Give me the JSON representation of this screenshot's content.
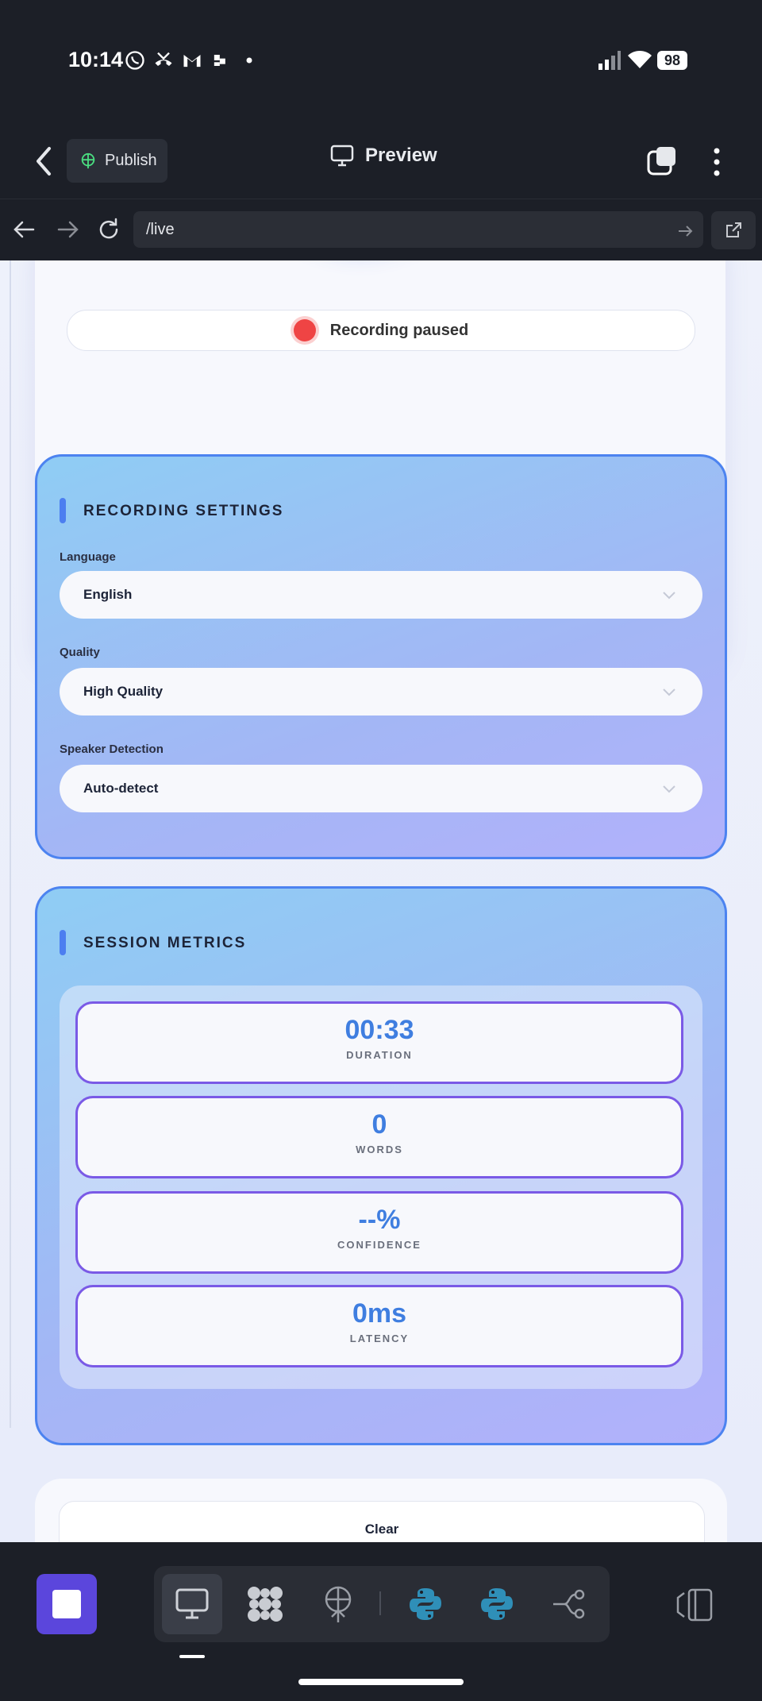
{
  "status_bar": {
    "time": "10:14",
    "battery": "98"
  },
  "header": {
    "publish_label": "Publish",
    "title": "Preview"
  },
  "browser": {
    "url": "/live"
  },
  "recording": {
    "status": "Recording paused"
  },
  "settings": {
    "title": "RECORDING SETTINGS",
    "fields": [
      {
        "label": "Language",
        "value": "English"
      },
      {
        "label": "Quality",
        "value": "High Quality"
      },
      {
        "label": "Speaker Detection",
        "value": "Auto-detect"
      }
    ]
  },
  "metrics": {
    "title": "SESSION METRICS",
    "items": [
      {
        "value": "00:33",
        "label": "DURATION"
      },
      {
        "value": "0",
        "label": "WORDS"
      },
      {
        "value": "--%",
        "label": "CONFIDENCE"
      },
      {
        "value": "0ms",
        "label": "LATENCY"
      }
    ]
  },
  "actions": {
    "clear_label": "Clear"
  },
  "colors": {
    "accent": "#4c83f0",
    "stop_button": "#5b46dc",
    "recording_dot": "#ef4444",
    "metric_value": "#3f7ee0"
  },
  "toolbar_icons": [
    "desktop-icon",
    "grid-blobs-icon",
    "antenna-icon",
    "python-icon",
    "python-icon",
    "workflow-icon"
  ]
}
